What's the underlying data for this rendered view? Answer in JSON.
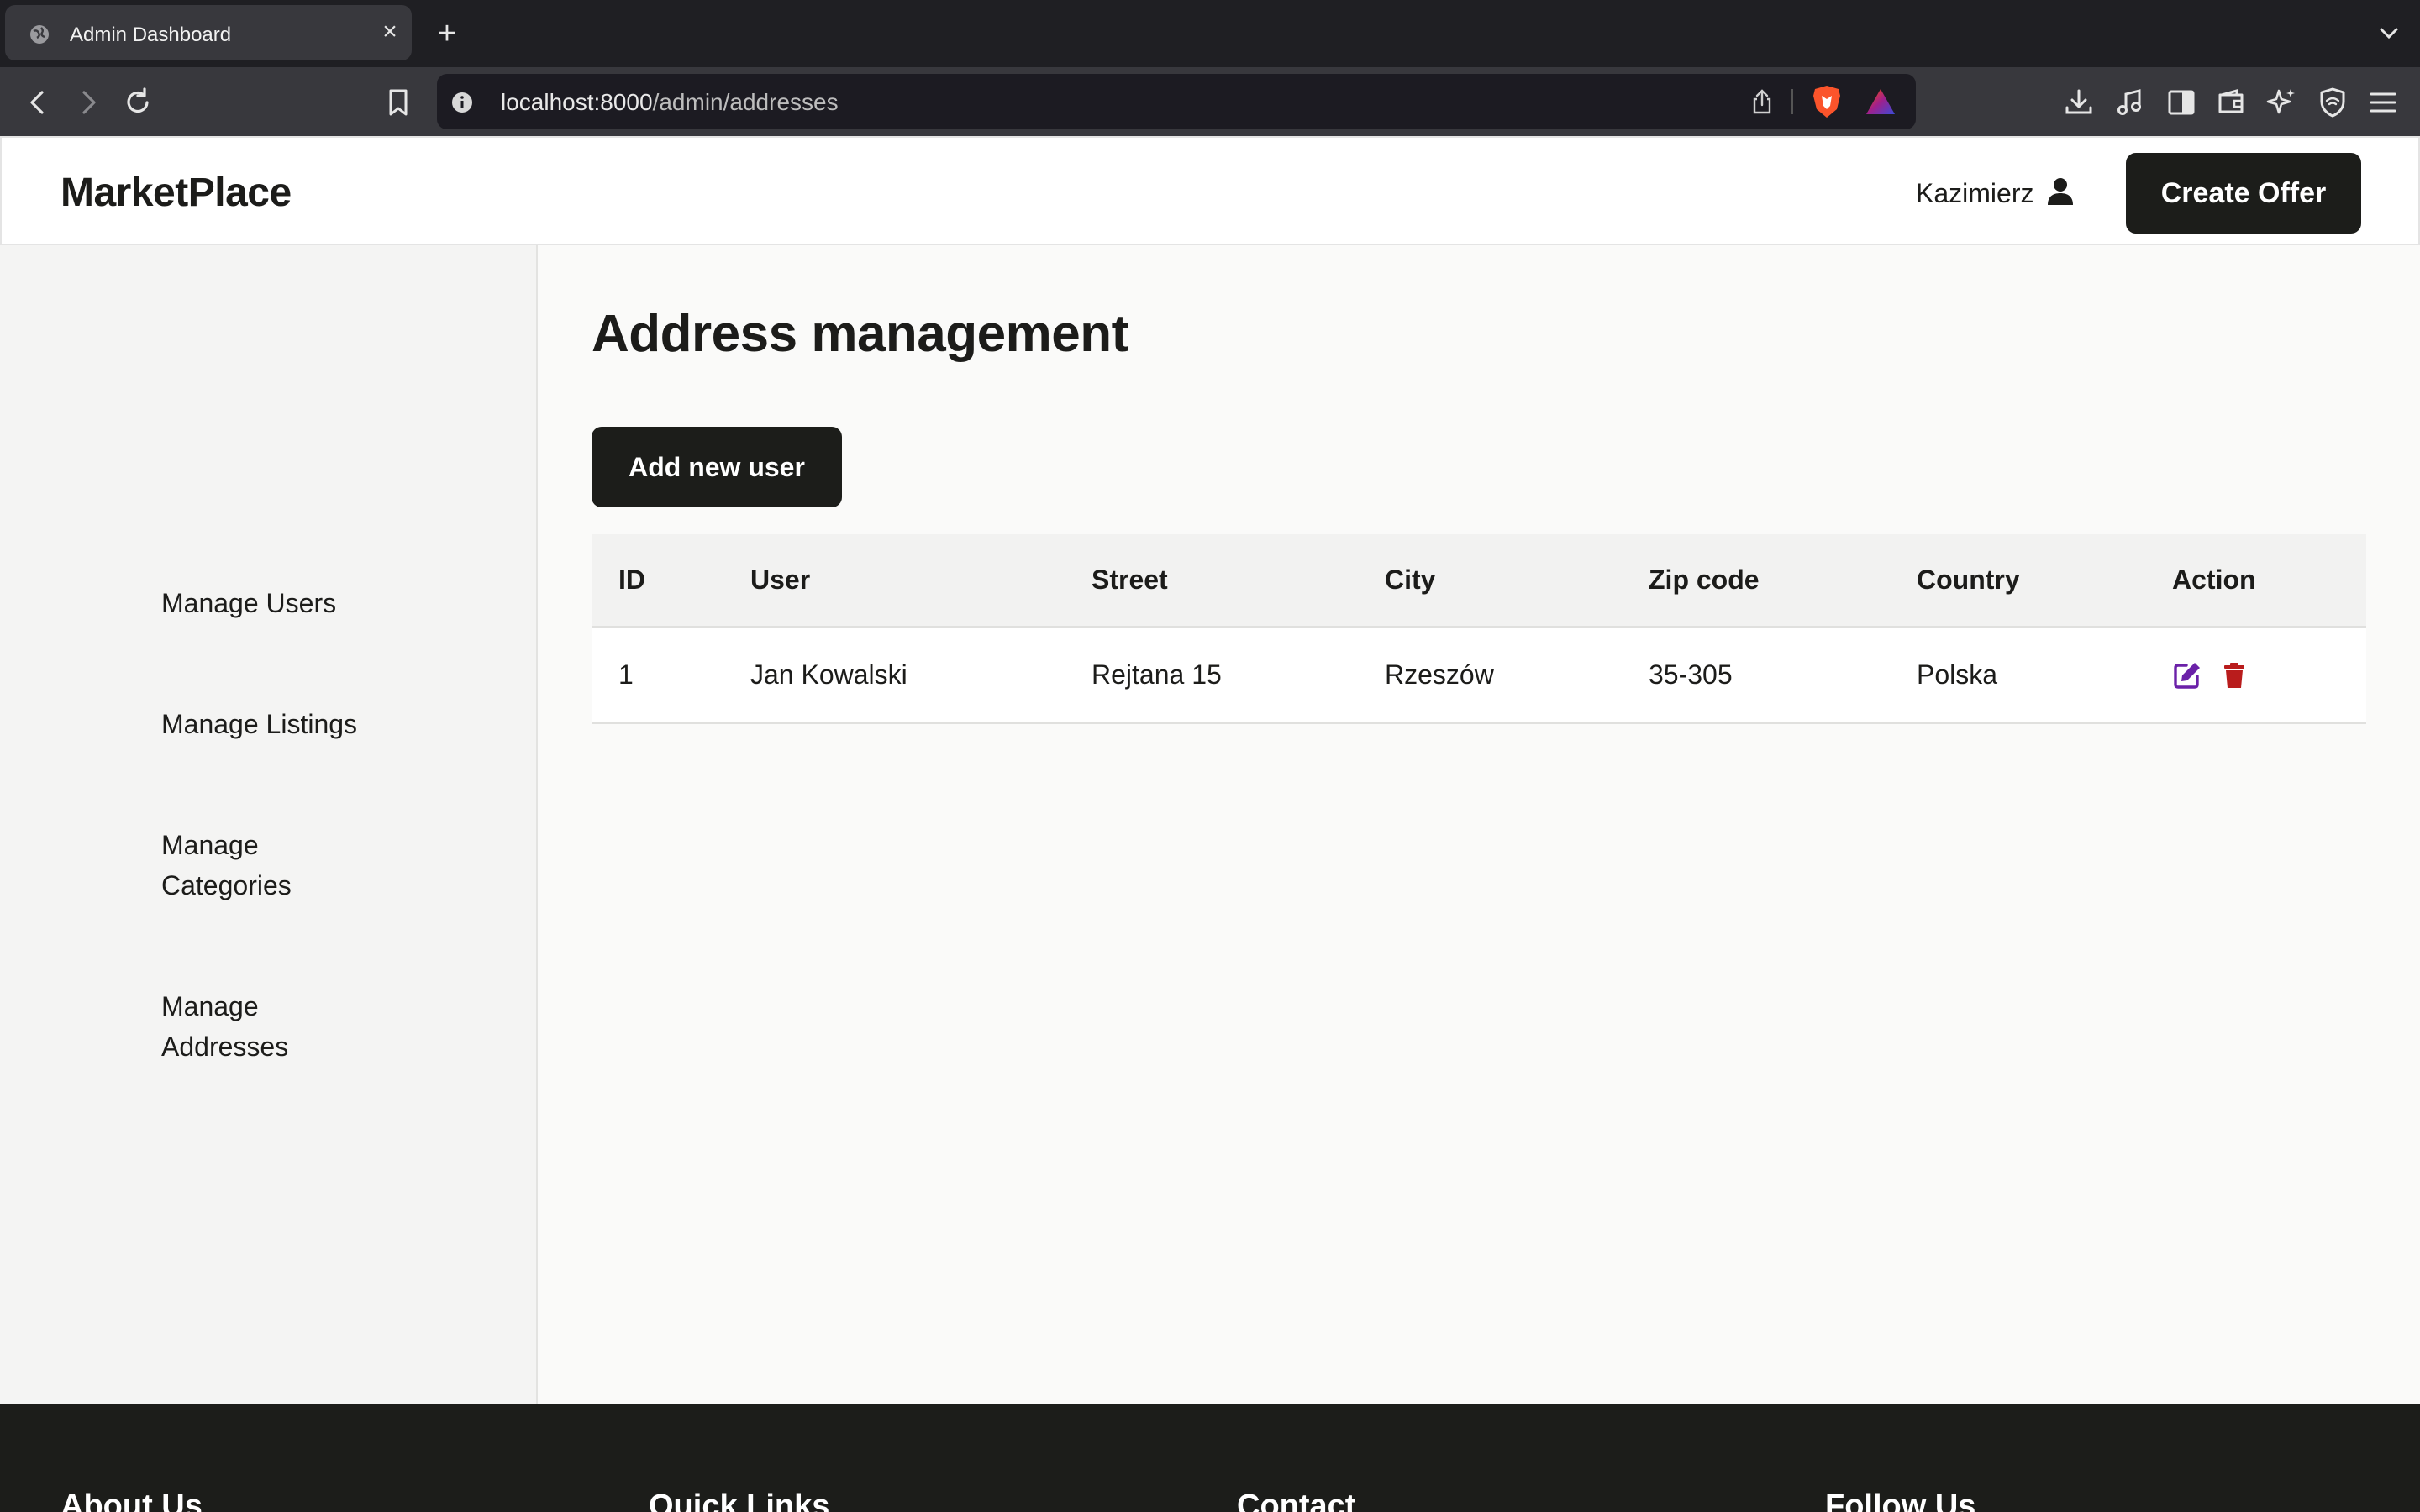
{
  "browser": {
    "tab_title": "Admin Dashboard",
    "url_host": "localhost:8000",
    "url_path": "/admin/addresses"
  },
  "header": {
    "logo": "MarketPlace",
    "user_name": "Kazimierz",
    "create_offer_label": "Create Offer"
  },
  "sidebar": {
    "items": [
      {
        "label": "Manage Users"
      },
      {
        "label": "Manage Listings"
      },
      {
        "label": "Manage Categories"
      },
      {
        "label": "Manage Addresses"
      }
    ]
  },
  "main": {
    "title": "Address management",
    "add_button_label": "Add new user",
    "table": {
      "columns": [
        "ID",
        "User",
        "Street",
        "City",
        "Zip code",
        "Country",
        "Action"
      ],
      "rows": [
        {
          "id": "1",
          "user": "Jan Kowalski",
          "street": "Rejtana 15",
          "city": "Rzeszów",
          "zip": "35-305",
          "country": "Polska"
        }
      ]
    }
  },
  "footer": {
    "headings": [
      "About Us",
      "Quick Links",
      "Contact",
      "Follow Us"
    ]
  },
  "colors": {
    "edit_icon": "#6b21a8",
    "delete_icon": "#b91c1c",
    "dark_button": "#1c1d1a"
  }
}
